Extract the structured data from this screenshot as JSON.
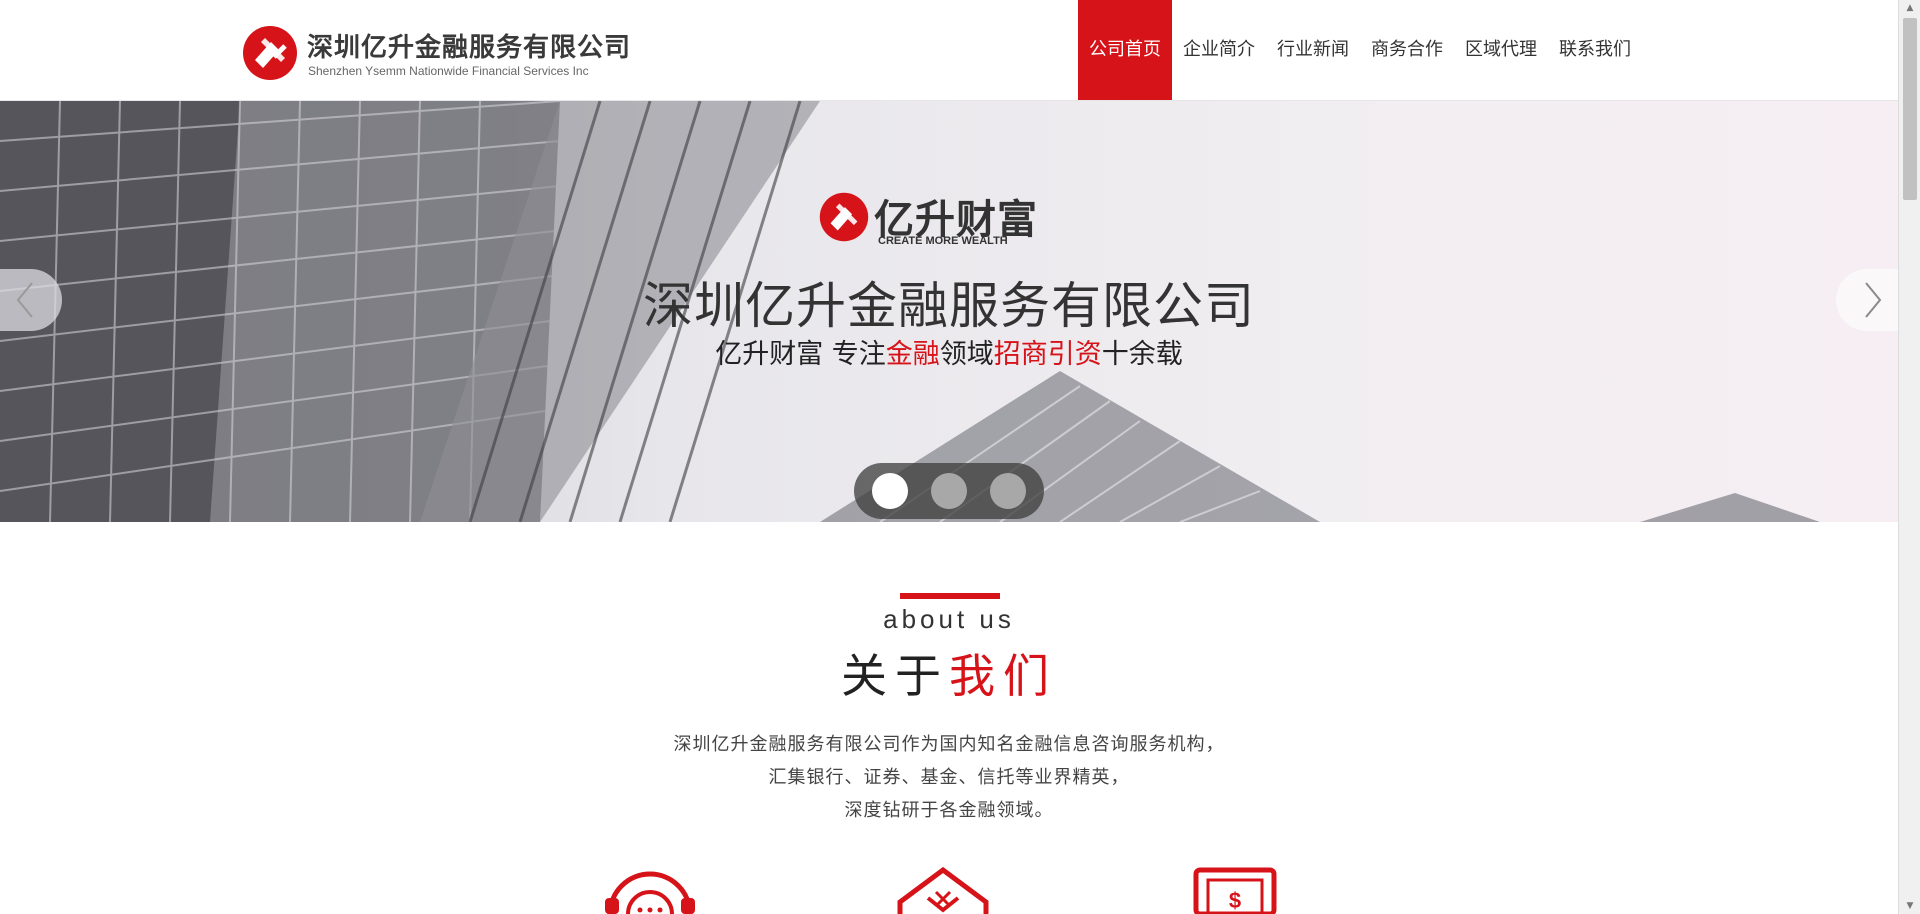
{
  "colors": {
    "accent": "#d7131a",
    "text": "#333333"
  },
  "header": {
    "logo_cn": "深圳亿升金融服务有限公司",
    "logo_en": "Shenzhen Ysemm Nationwide Financial Services Inc",
    "nav": [
      {
        "label": "公司首页",
        "active": true
      },
      {
        "label": "企业简介",
        "active": false
      },
      {
        "label": "行业新闻",
        "active": false
      },
      {
        "label": "商务合作",
        "active": false
      },
      {
        "label": "区域代理",
        "active": false
      },
      {
        "label": "联系我们",
        "active": false
      }
    ]
  },
  "banner": {
    "brand_name": "亿升财富",
    "brand_sub": "CREATE MORE WEALTH",
    "title": "深圳亿升金融服务有限公司",
    "slogan": {
      "part1": "亿升财富 专注",
      "red1": "金融",
      "part2": "领域",
      "red2": "招商引资",
      "part3": "十余载"
    },
    "slides_total": 3,
    "slide_active": 1
  },
  "about": {
    "en": "about us",
    "cn_black": "关于",
    "cn_red": "我们",
    "lines": [
      "深圳亿升金融服务有限公司作为国内知名金融信息咨询服务机构，",
      "汇集银行、证券、基金、信托等业界精英，",
      "深度钻研于各金融领域。"
    ],
    "icons": [
      "headset-icon",
      "envelope-icon",
      "card-dollar-icon"
    ]
  }
}
